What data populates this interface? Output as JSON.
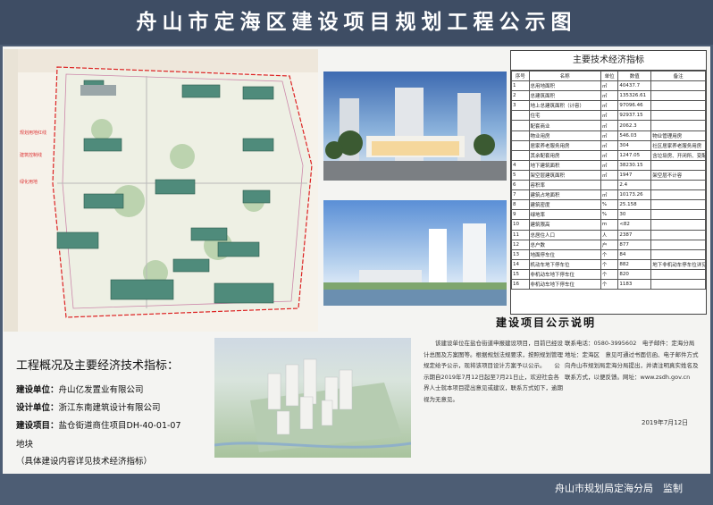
{
  "header": {
    "title": "舟山市定海区建设项目规划工程公示图"
  },
  "tech_table": {
    "title": "主要技术经济指标",
    "columns": [
      "序号",
      "名称",
      "单位",
      "数值",
      "备注"
    ],
    "rows": [
      [
        "1",
        "总用地面积",
        "㎡",
        "40437.7",
        ""
      ],
      [
        "2",
        "总建筑面积",
        "㎡",
        "135326.61",
        ""
      ],
      [
        "3",
        "地上总建筑面积（计容）",
        "㎡",
        "97096.46",
        ""
      ],
      [
        "",
        "住宅",
        "㎡",
        "92937.15",
        ""
      ],
      [
        "",
        "配套商业",
        "㎡",
        "2062.3",
        ""
      ],
      [
        "",
        "物业用房",
        "㎡",
        "546.03",
        "物业管理用房"
      ],
      [
        "",
        "居家养老服务用房",
        "㎡",
        "304",
        "社区居家养老服务用房"
      ],
      [
        "",
        "其余配套用房",
        "㎡",
        "1247.05",
        "含垃圾房、开闭所、变配电、公厕等"
      ],
      [
        "4",
        "地下建筑面积",
        "㎡",
        "38230.15",
        ""
      ],
      [
        "5",
        "架空层建筑面积",
        "㎡",
        "1947",
        "架空层不计容"
      ],
      [
        "6",
        "容积率",
        "",
        "2.4",
        ""
      ],
      [
        "7",
        "建筑占地面积",
        "㎡",
        "10173.26",
        ""
      ],
      [
        "8",
        "建筑密度",
        "%",
        "25.158",
        ""
      ],
      [
        "9",
        "绿地率",
        "%",
        "30",
        ""
      ],
      [
        "10",
        "建筑限高",
        "m",
        "<82",
        ""
      ],
      [
        "11",
        "总居住人口",
        "人",
        "2387",
        ""
      ],
      [
        "12",
        "总户数",
        "户",
        "877",
        ""
      ],
      [
        "13",
        "地面停车位",
        "个",
        "84",
        ""
      ],
      [
        "14",
        "机动车地下停车位",
        "个",
        "882",
        "地下非机动车停车位详见图纸"
      ],
      [
        "15",
        "非机动车地下停车位",
        "个",
        "820",
        ""
      ],
      [
        "16",
        "非机动车地下停车位",
        "个",
        "1183",
        ""
      ]
    ]
  },
  "overview": {
    "title": "工程概况及主要经济技术指标：",
    "lines": [
      {
        "label": "建设单位：",
        "value": "舟山亿发置业有限公司"
      },
      {
        "label": "设计单位：",
        "value": "浙江东南建筑设计有限公司"
      },
      {
        "label": "建设项目：",
        "value": "盐仓街道商住项目DH-40-01-07"
      },
      {
        "label": "",
        "value": "地块"
      },
      {
        "label": "",
        "value": "（具体建设内容详见技术经济指标）"
      }
    ]
  },
  "notice": {
    "title": "建设项目公示说明",
    "left_text": "　　该建设单位在盐仓街道申报建设项目，目前已经设计总图及方案图等。根据规划法规要求，按照规划管理规定给予公示，现将该项目设计方案予以公示。　　公示期自2019年7月12日起至7月21日止，欢迎社会各界人士就本项目提出意见或建议，联系方式如下，逾期视为无意见。",
    "right_text": "联系电话：0580-3995602　电子邮件：定海分局　地址：定海区　意见可通过书面信函、电子邮件方式向舟山市规划局定海分局提出，并请注明真实姓名及联系方式，以便反馈。网址：www.zsdh.gov.cn",
    "date": "2019年7月12日"
  },
  "footer": {
    "text": "舟山市规划局定海分局　监制"
  },
  "colors": {
    "header_bg": "#3e4d64",
    "footer_bg": "#4d5d74",
    "board_bg": "#f4f4f2",
    "building": "#4f8b7b"
  }
}
